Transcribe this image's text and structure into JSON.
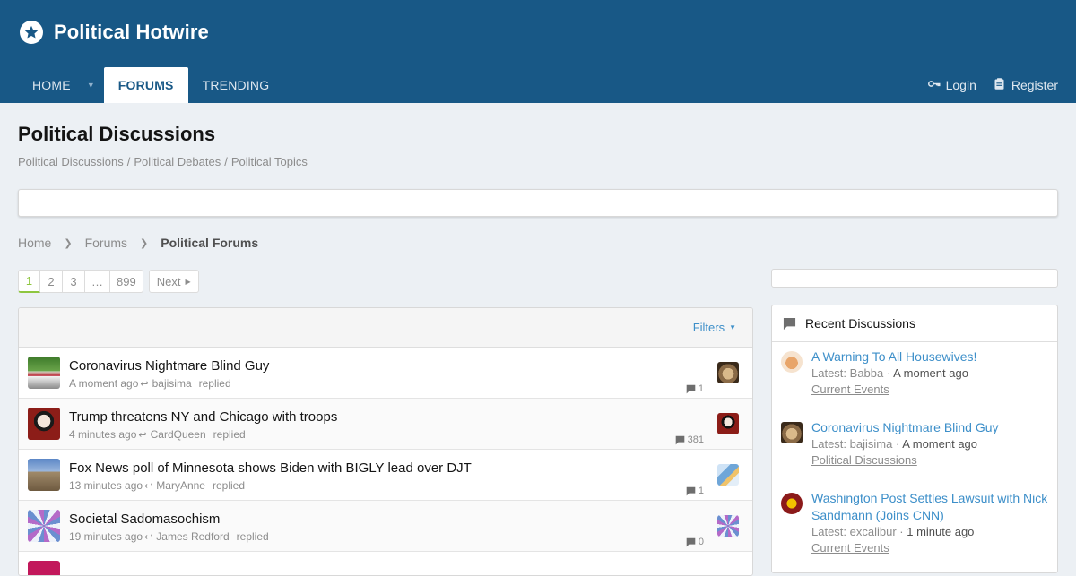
{
  "site": {
    "name": "Political Hotwire",
    "logo_icon": "star-badge-icon"
  },
  "nav": {
    "tabs": [
      {
        "label": "HOME",
        "active": false
      },
      {
        "label": "FORUMS",
        "active": true
      },
      {
        "label": "TRENDING",
        "active": false
      }
    ],
    "login_label": "Login",
    "register_label": "Register"
  },
  "page": {
    "title": "Political Discussions",
    "subtitle": [
      "Political Discussions",
      "Political Debates",
      "Political Topics"
    ],
    "subtitle_sep": "/"
  },
  "breadcrumb": [
    "Home",
    "Forums",
    "Political Forums"
  ],
  "pagination": {
    "pages": [
      "1",
      "2",
      "3",
      "…",
      "899"
    ],
    "current": "1",
    "next_label": "Next"
  },
  "threads": {
    "filters_label": "Filters",
    "items": [
      {
        "title": "Coronavirus Nightmare Blind Guy",
        "time": "A moment ago",
        "user": "bajisima",
        "action": "replied",
        "count": "1",
        "avatar": "tree-avatar",
        "last_avatar": "dog-avatar"
      },
      {
        "title": "Trump threatens NY and Chicago with troops",
        "time": "4 minutes ago",
        "user": "CardQueen",
        "action": "replied",
        "count": "381",
        "avatar": "queen-avatar",
        "last_avatar": "queen-avatar"
      },
      {
        "title": "Fox News poll of Minnesota shows Biden with BIGLY lead over DJT",
        "time": "13 minutes ago",
        "user": "MaryAnne",
        "action": "replied",
        "count": "1",
        "avatar": "rock-avatar",
        "last_avatar": "blocks-avatar"
      },
      {
        "title": "Societal Sadomasochism",
        "time": "19 minutes ago",
        "user": "James Redford",
        "action": "replied",
        "count": "0",
        "avatar": "spiral-avatar",
        "last_avatar": "spiral-avatar"
      }
    ]
  },
  "sidebar": {
    "heading": "Recent Discussions",
    "items": [
      {
        "title": "A Warning To All Housewives!",
        "latest_prefix": "Latest:",
        "user": "Babba",
        "when": "A moment ago",
        "forum": "Current Events",
        "avatar": "bear-avatar"
      },
      {
        "title": "Coronavirus Nightmare Blind Guy",
        "latest_prefix": "Latest:",
        "user": "bajisima",
        "when": "A moment ago",
        "forum": "Political Discussions",
        "avatar": "dog-avatar"
      },
      {
        "title": "Washington Post Settles Lawsuit with Nick Sandmann (Joins CNN)",
        "latest_prefix": "Latest:",
        "user": "excalibur",
        "when": "1 minute ago",
        "forum": "Current Events",
        "avatar": "redskins-avatar"
      }
    ]
  },
  "colors": {
    "header": "#185886",
    "link": "#3d8fc9",
    "accent_green": "#8ec63f",
    "page_bg": "#ecf0f4"
  }
}
